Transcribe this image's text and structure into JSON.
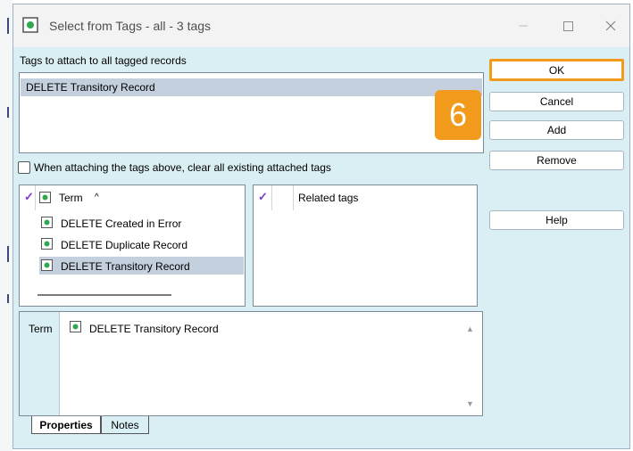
{
  "window": {
    "title": "Select from Tags - all - 3 tags",
    "controls": {
      "minimize": "—",
      "maximize": "☐",
      "close": "✕"
    }
  },
  "attach_section": {
    "label": "Tags to attach to all tagged records",
    "items": [
      "DELETE Transitory Record"
    ]
  },
  "callout_badge": "6",
  "buttons": {
    "ok": "OK",
    "cancel": "Cancel",
    "add": "Add",
    "remove": "Remove",
    "help": "Help"
  },
  "clear_checkbox": {
    "label": "When attaching the tags above, clear all existing attached tags",
    "checked": false
  },
  "term_list": {
    "header": "Term",
    "sort_indicator": "^",
    "items": [
      {
        "label": "DELETE Created in Error",
        "selected": false
      },
      {
        "label": "DELETE Duplicate Record",
        "selected": false
      },
      {
        "label": "DELETE Transitory Record",
        "selected": true
      }
    ]
  },
  "related_tags": {
    "header": "Related tags"
  },
  "properties": {
    "label": "Term",
    "value": "DELETE Transitory Record"
  },
  "tabs": [
    "Properties",
    "Notes"
  ],
  "colors": {
    "accent_orange": "#f29a1b",
    "check_purple": "#7d3cc8",
    "tag_icon_green": "#2fa84f",
    "selection": "#c4d0de",
    "dialog_bg": "#daeff3"
  }
}
